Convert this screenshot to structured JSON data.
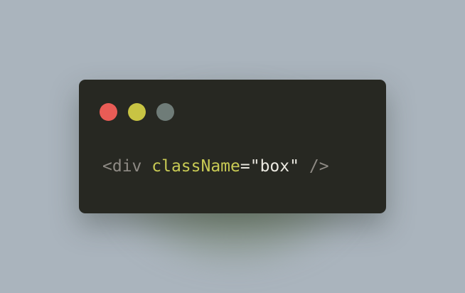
{
  "window": {
    "controls": [
      {
        "name": "close-dot",
        "color": "#e95c56"
      },
      {
        "name": "minimize-dot",
        "color": "#c8c443"
      },
      {
        "name": "maximize-dot",
        "color": "#6f7c78"
      }
    ]
  },
  "code": {
    "tokens": [
      {
        "name": "tag-open",
        "text": "<div",
        "color": "#8e8a84"
      },
      {
        "name": "space-1",
        "text": " ",
        "color": "#8e8a84"
      },
      {
        "name": "attr-name",
        "text": "className",
        "color": "#c8ca54"
      },
      {
        "name": "equals",
        "text": "=",
        "color": "#e8e6dd"
      },
      {
        "name": "attr-value",
        "text": "\"box\"",
        "color": "#ebe9e1"
      },
      {
        "name": "space-2",
        "text": " ",
        "color": "#8e8a84"
      },
      {
        "name": "tag-close",
        "text": "/>",
        "color": "#8e8a84"
      }
    ]
  }
}
